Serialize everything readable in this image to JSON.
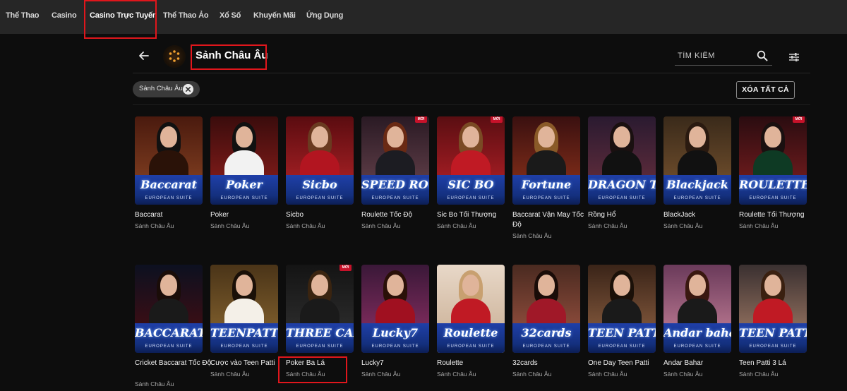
{
  "nav": {
    "items": [
      "Thể Thao",
      "Casino",
      "Casino Trực Tuyến",
      "Thể Thao Ảo",
      "Xổ Số",
      "Khuyến Mãi",
      "Ứng Dụng"
    ],
    "active_index": 2
  },
  "header": {
    "title": "Sảnh Châu Âu",
    "search_placeholder": "TÌM KIẾM"
  },
  "filters": {
    "chip_label": "Sảnh Châu Âu",
    "clear_all_label": "XÓA TẤT CẢ"
  },
  "badge_label": "MỚI",
  "suite_label": "EUROPEAN SUITE",
  "games": [
    {
      "name": "Baccarat",
      "provider": "Sảnh Châu Âu",
      "logo": "Baccarat",
      "new": false
    },
    {
      "name": "Poker",
      "provider": "Sảnh Châu Âu",
      "logo": "Poker",
      "new": false
    },
    {
      "name": "Sicbo",
      "provider": "Sảnh Châu Âu",
      "logo": "Sicbo",
      "new": false
    },
    {
      "name": "Roulette Tốc Độ",
      "provider": "Sảnh Châu Âu",
      "logo": "SPEED ROULETTE",
      "new": true
    },
    {
      "name": "Sic Bo Tối Thượng",
      "provider": "Sảnh Châu Âu",
      "logo": "SIC BO",
      "new": true
    },
    {
      "name": "Baccarat Vận May Tốc Độ",
      "provider": "Sảnh Châu Âu",
      "logo": "Fortune",
      "new": false
    },
    {
      "name": "Rồng Hổ",
      "provider": "Sảnh Châu Âu",
      "logo": "DRAGON TIGER",
      "new": false
    },
    {
      "name": "BlackJack",
      "provider": "Sảnh Châu Âu",
      "logo": "Blackjack",
      "new": false
    },
    {
      "name": "Roulette Tối Thượng",
      "provider": "Sảnh Châu Âu",
      "logo": "ROULETTE",
      "new": true
    },
    {
      "name": "Cricket Baccarat Tốc Độ",
      "provider": "Sảnh Châu Âu",
      "logo": "BACCARAT",
      "new": false
    },
    {
      "name": "Cược vào Teen Patti",
      "provider": "Sảnh Châu Âu",
      "logo": "TEENPATTI",
      "new": false
    },
    {
      "name": "Poker Ba Lá",
      "provider": "Sảnh Châu Âu",
      "logo": "THREE CARD",
      "new": true
    },
    {
      "name": "Lucky7",
      "provider": "Sảnh Châu Âu",
      "logo": "Lucky7",
      "new": false
    },
    {
      "name": "Roulette",
      "provider": "Sảnh Châu Âu",
      "logo": "Roulette",
      "new": false
    },
    {
      "name": "32cards",
      "provider": "Sảnh Châu Âu",
      "logo": "32cards",
      "new": false
    },
    {
      "name": "One Day Teen Patti",
      "provider": "Sảnh Châu Âu",
      "logo": "TEEN PATTI",
      "new": false
    },
    {
      "name": "Andar Bahar",
      "provider": "Sảnh Châu Âu",
      "logo": "Andar bahar",
      "new": false
    },
    {
      "name": "Teen Patti 3 Lá",
      "provider": "Sảnh Châu Âu",
      "logo": "TEEN PATTI",
      "new": false
    }
  ],
  "colors": {
    "highlight": "#e0161c",
    "panel_blue": "#1f3fa8",
    "badge_red": "#c7122a"
  }
}
